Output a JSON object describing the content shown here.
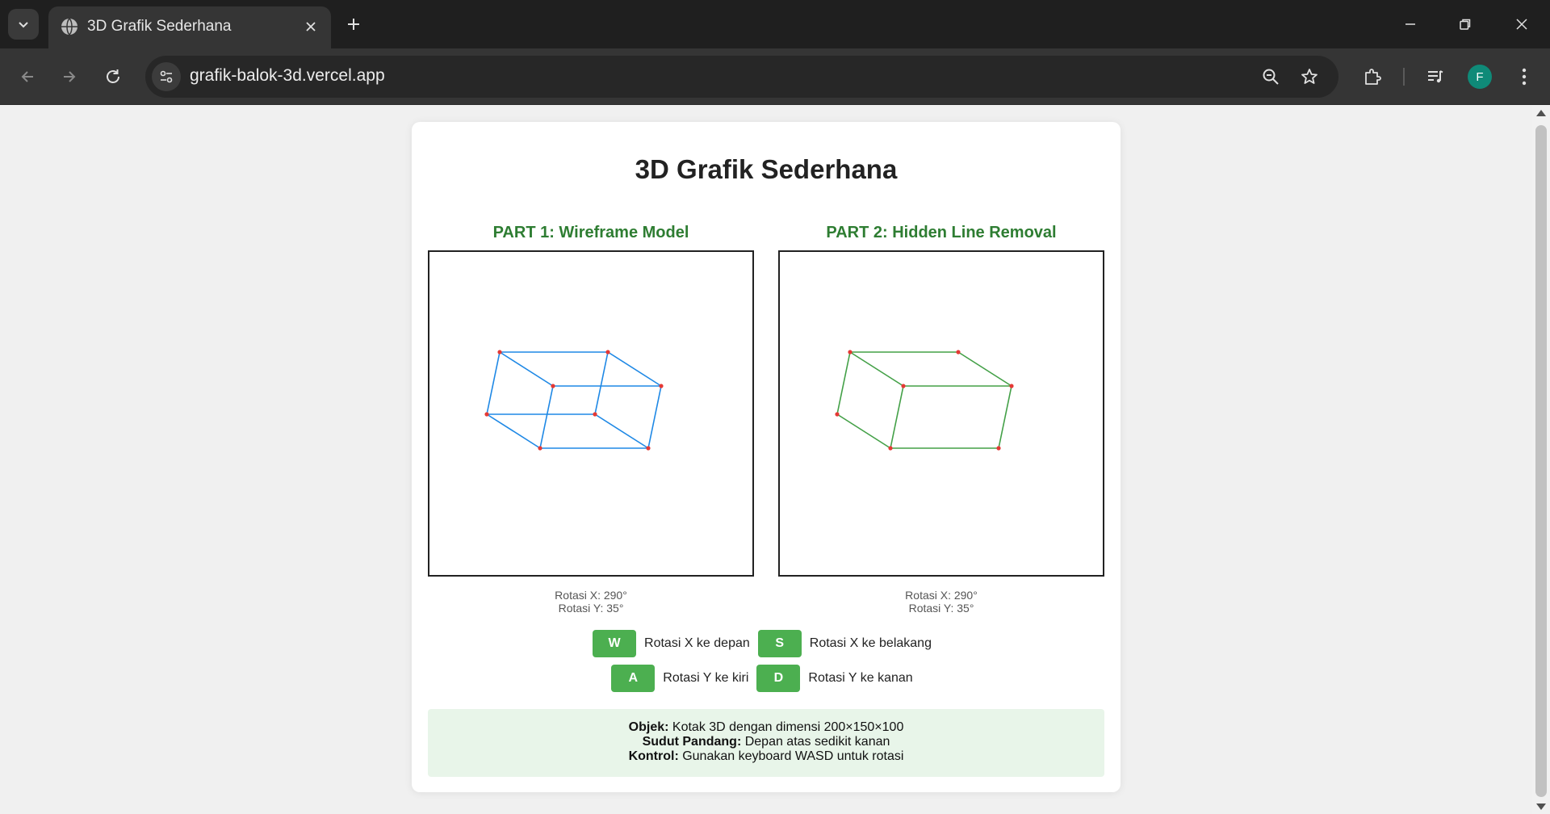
{
  "browser": {
    "tab_title": "3D Grafik Sederhana",
    "url": "grafik-balok-3d.vercel.app",
    "profile_initial": "F"
  },
  "page": {
    "title": "3D Grafik Sederhana",
    "part1": {
      "title": "PART 1: Wireframe Model",
      "rotation_x": "Rotasi X: 290°",
      "rotation_y": "Rotasi Y: 35°"
    },
    "part2": {
      "title": "PART 2: Hidden Line Removal",
      "rotation_x": "Rotasi X: 290°",
      "rotation_y": "Rotasi Y: 35°"
    },
    "controls": [
      {
        "key": "W",
        "label": "Rotasi X ke depan"
      },
      {
        "key": "S",
        "label": "Rotasi X ke belakang"
      },
      {
        "key": "A",
        "label": "Rotasi Y ke kiri"
      },
      {
        "key": "D",
        "label": "Rotasi Y ke kanan"
      }
    ],
    "info": {
      "object_label": "Objek:",
      "object_value": " Kotak 3D dengan dimensi 200×150×100",
      "view_label": "Sudut Pandang:",
      "view_value": " Depan atas sedikit kanan",
      "control_label": "Kontrol:",
      "control_value": " Gunakan keyboard WASD untuk rotasi"
    }
  },
  "colors": {
    "wireframe": "#1e88e5",
    "hidden_line": "#43a047",
    "vertex": "#e53935",
    "accent": "#4caf50",
    "heading": "#2e7d32"
  }
}
